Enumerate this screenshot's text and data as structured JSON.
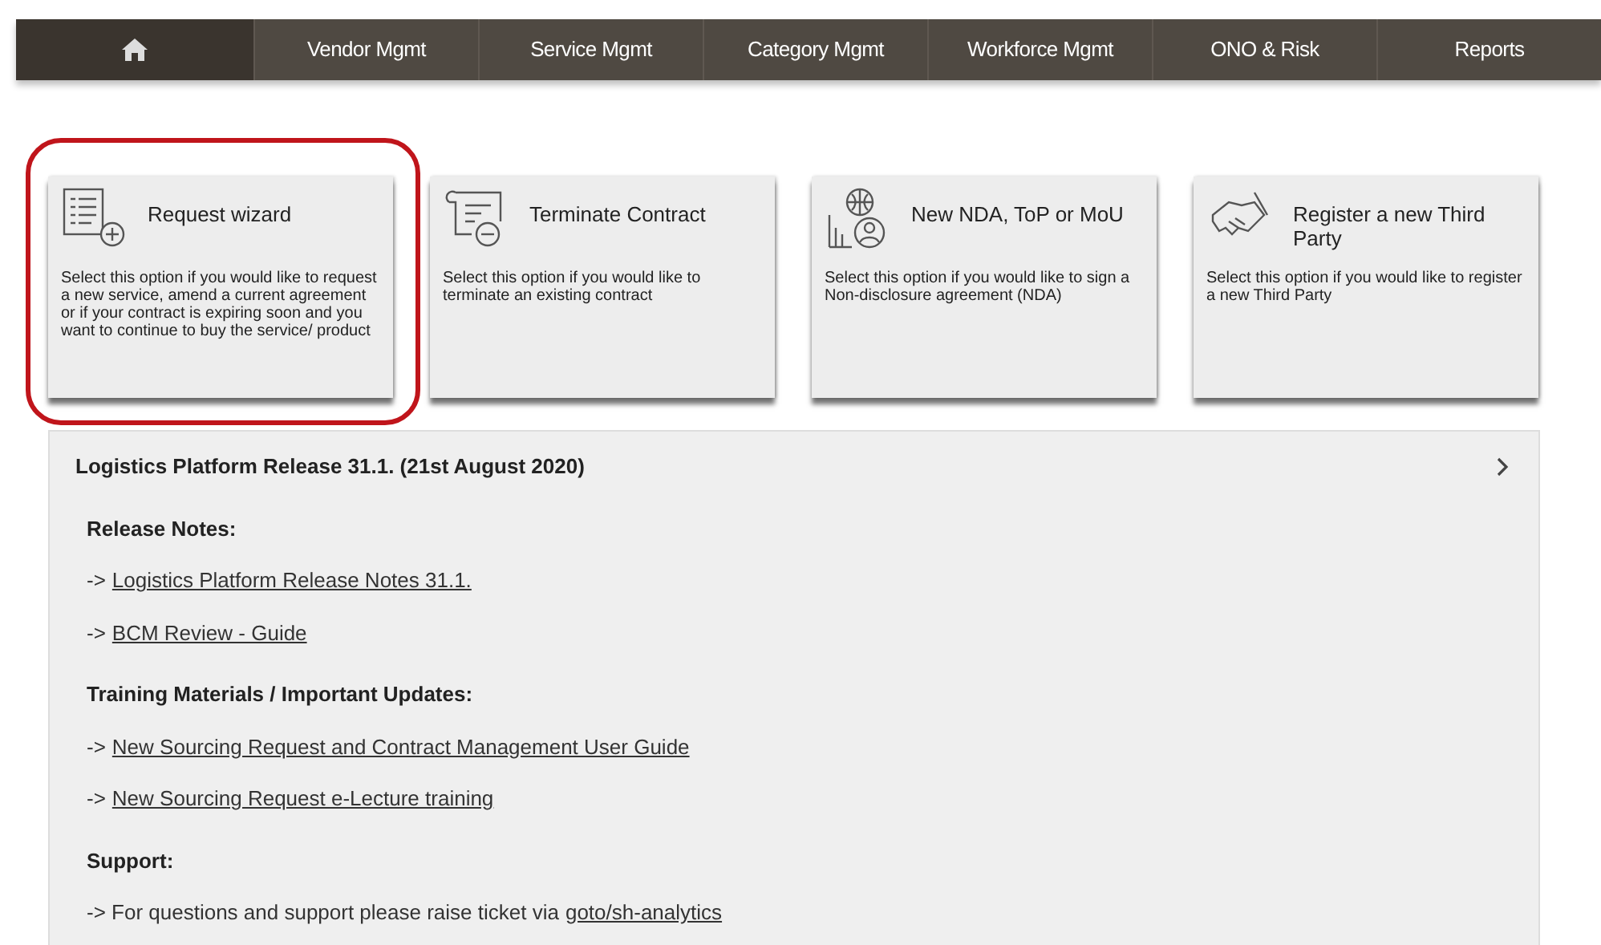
{
  "nav": {
    "items": [
      {
        "kind": "home",
        "selected": true
      },
      {
        "kind": "tab",
        "label": "Vendor Mgmt",
        "selected": false
      },
      {
        "kind": "tab",
        "label": "Service Mgmt",
        "selected": false
      },
      {
        "kind": "tab",
        "label": "Category Mgmt",
        "selected": false
      },
      {
        "kind": "tab",
        "label": "Workforce Mgmt",
        "selected": false
      },
      {
        "kind": "tab",
        "label": "ONO & Risk",
        "selected": false
      },
      {
        "kind": "tab",
        "label": "Reports",
        "selected": false
      }
    ]
  },
  "cards": [
    {
      "kind": "request",
      "title": "Request wizard",
      "description": "Select this option if you would like to request a new service, amend a current agreement or if your contract is expiring soon and you want to continue to buy the service/ product",
      "highlighted": true
    },
    {
      "kind": "terminate",
      "title": "Terminate Contract",
      "description": "Select this option if you would like to terminate an existing contract",
      "highlighted": false
    },
    {
      "kind": "nda",
      "title": "New NDA, ToP or MoU",
      "description": "Select this option if you would like to sign a Non-disclosure agreement (NDA)",
      "highlighted": false
    },
    {
      "kind": "thirdparty",
      "title": "Register a new Third Party",
      "description": "Select this option if you would like to register a new Third Party",
      "highlighted": false
    }
  ],
  "panel": {
    "title": "Logistics Platform Release 31.1. (21st August 2020)",
    "sections": [
      {
        "heading": "Release Notes:",
        "lines": [
          {
            "text": "->",
            "link": "Logistics Platform Release Notes 31.1."
          },
          {
            "text": "->",
            "link": "BCM Review - Guide"
          }
        ]
      },
      {
        "heading": "Training Materials / Important Updates:",
        "lines": [
          {
            "text": "->",
            "link": "New Sourcing Request and Contract Management User Guide"
          },
          {
            "text": "->",
            "link": "New Sourcing Request e-Lecture training"
          }
        ]
      },
      {
        "heading": "Support:",
        "lines": [
          {
            "text": "-> For questions and support please raise ticket via",
            "link": "goto/sh-analytics"
          }
        ]
      }
    ]
  }
}
